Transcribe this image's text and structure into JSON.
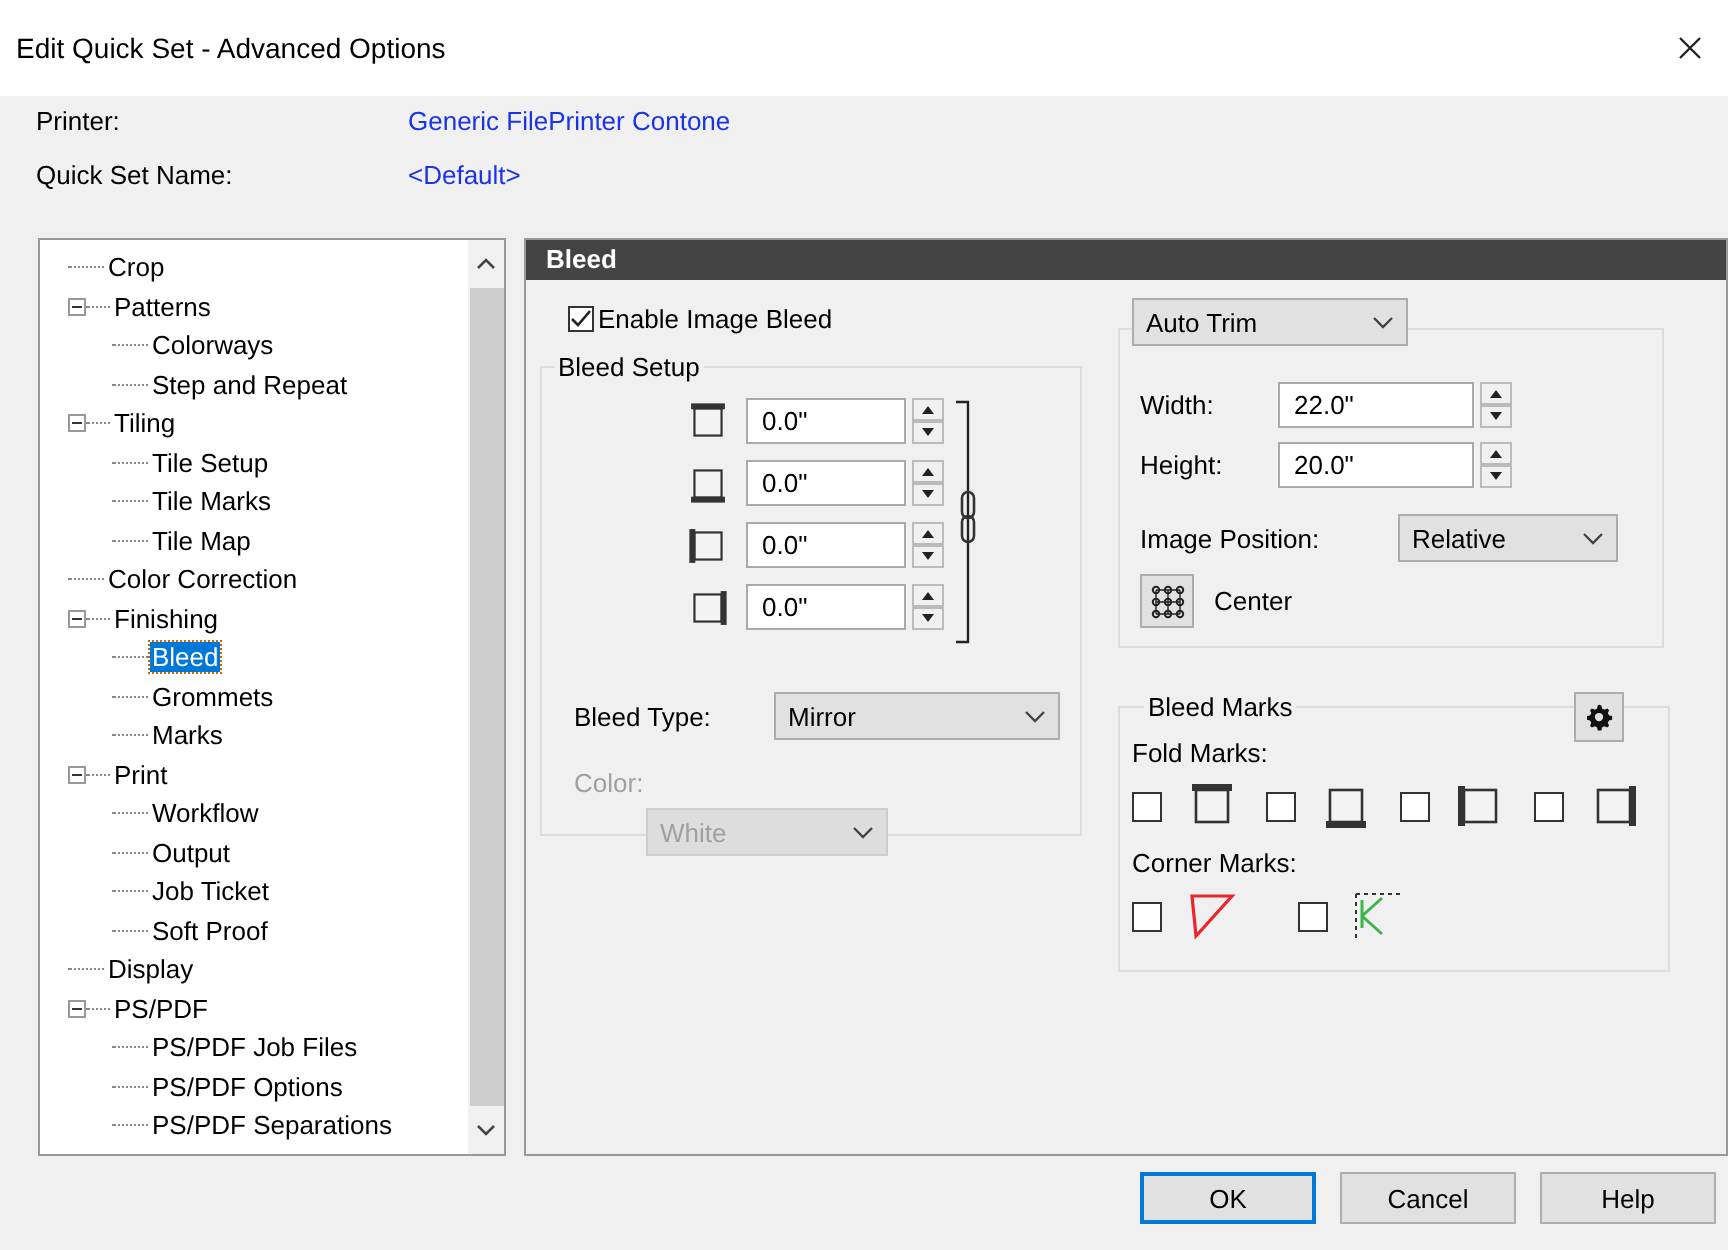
{
  "window": {
    "title": "Edit Quick Set - Advanced Options"
  },
  "header": [
    {
      "label": "Printer:",
      "value": "Generic FilePrinter Contone"
    },
    {
      "label": "Quick Set Name:",
      "value": "<Default>"
    }
  ],
  "tree": {
    "items": [
      {
        "label": "Crop",
        "selected": false
      },
      {
        "label": "Patterns",
        "selected": false,
        "expanded": true,
        "children": [
          {
            "label": "Colorways",
            "selected": false
          },
          {
            "label": "Step and Repeat",
            "selected": false
          }
        ]
      },
      {
        "label": "Tiling",
        "selected": false,
        "expanded": true,
        "children": [
          {
            "label": "Tile Setup",
            "selected": false
          },
          {
            "label": "Tile Marks",
            "selected": false
          },
          {
            "label": "Tile Map",
            "selected": false
          }
        ]
      },
      {
        "label": "Color Correction",
        "selected": false
      },
      {
        "label": "Finishing",
        "selected": false,
        "expanded": true,
        "children": [
          {
            "label": "Bleed",
            "selected": true
          },
          {
            "label": "Grommets",
            "selected": false
          },
          {
            "label": "Marks",
            "selected": false
          }
        ]
      },
      {
        "label": "Print",
        "selected": false,
        "expanded": true,
        "children": [
          {
            "label": "Workflow",
            "selected": false
          },
          {
            "label": "Output",
            "selected": false
          },
          {
            "label": "Job Ticket",
            "selected": false
          },
          {
            "label": "Soft Proof",
            "selected": false
          }
        ]
      },
      {
        "label": "Display",
        "selected": false
      },
      {
        "label": "PS/PDF",
        "selected": false,
        "expanded": true,
        "children": [
          {
            "label": "PS/PDF Job Files",
            "selected": false
          },
          {
            "label": "PS/PDF Options",
            "selected": false
          },
          {
            "label": "PS/PDF Separations",
            "selected": false
          }
        ]
      }
    ]
  },
  "panel": {
    "title": "Bleed",
    "enable_bleed": {
      "label": "Enable Image Bleed",
      "checked": true
    },
    "bleed_setup": {
      "title": "Bleed Setup",
      "edges": [
        {
          "kind": "top",
          "value": "0.0\""
        },
        {
          "kind": "bottom",
          "value": "0.0\""
        },
        {
          "kind": "left",
          "value": "0.0\""
        },
        {
          "kind": "right",
          "value": "0.0\""
        }
      ],
      "bleed_type": {
        "label": "Bleed Type:",
        "value": "Mirror"
      },
      "color": {
        "label": "Color:",
        "value": "White",
        "disabled": true
      }
    },
    "trim": {
      "mode": "Auto Trim",
      "width": {
        "label": "Width:",
        "value": "22.0\""
      },
      "height": {
        "label": "Height:",
        "value": "20.0\""
      },
      "position": {
        "label": "Image Position:",
        "value": "Relative"
      },
      "anchor": "Center"
    },
    "bleed_marks": {
      "title": "Bleed Marks",
      "fold_label": "Fold Marks:",
      "fold": [
        {
          "kind": "top",
          "checked": false
        },
        {
          "kind": "bottom",
          "checked": false
        },
        {
          "kind": "left",
          "checked": false
        },
        {
          "kind": "right",
          "checked": false
        }
      ],
      "corner_label": "Corner Marks:",
      "corner": [
        {
          "kind": "triangle",
          "checked": false,
          "color": "#e8262b"
        },
        {
          "kind": "angle",
          "checked": false,
          "color": "#3cb54a"
        }
      ]
    }
  },
  "buttons": [
    {
      "label": "OK",
      "default": true
    },
    {
      "label": "Cancel",
      "default": false
    },
    {
      "label": "Help",
      "default": false
    }
  ]
}
